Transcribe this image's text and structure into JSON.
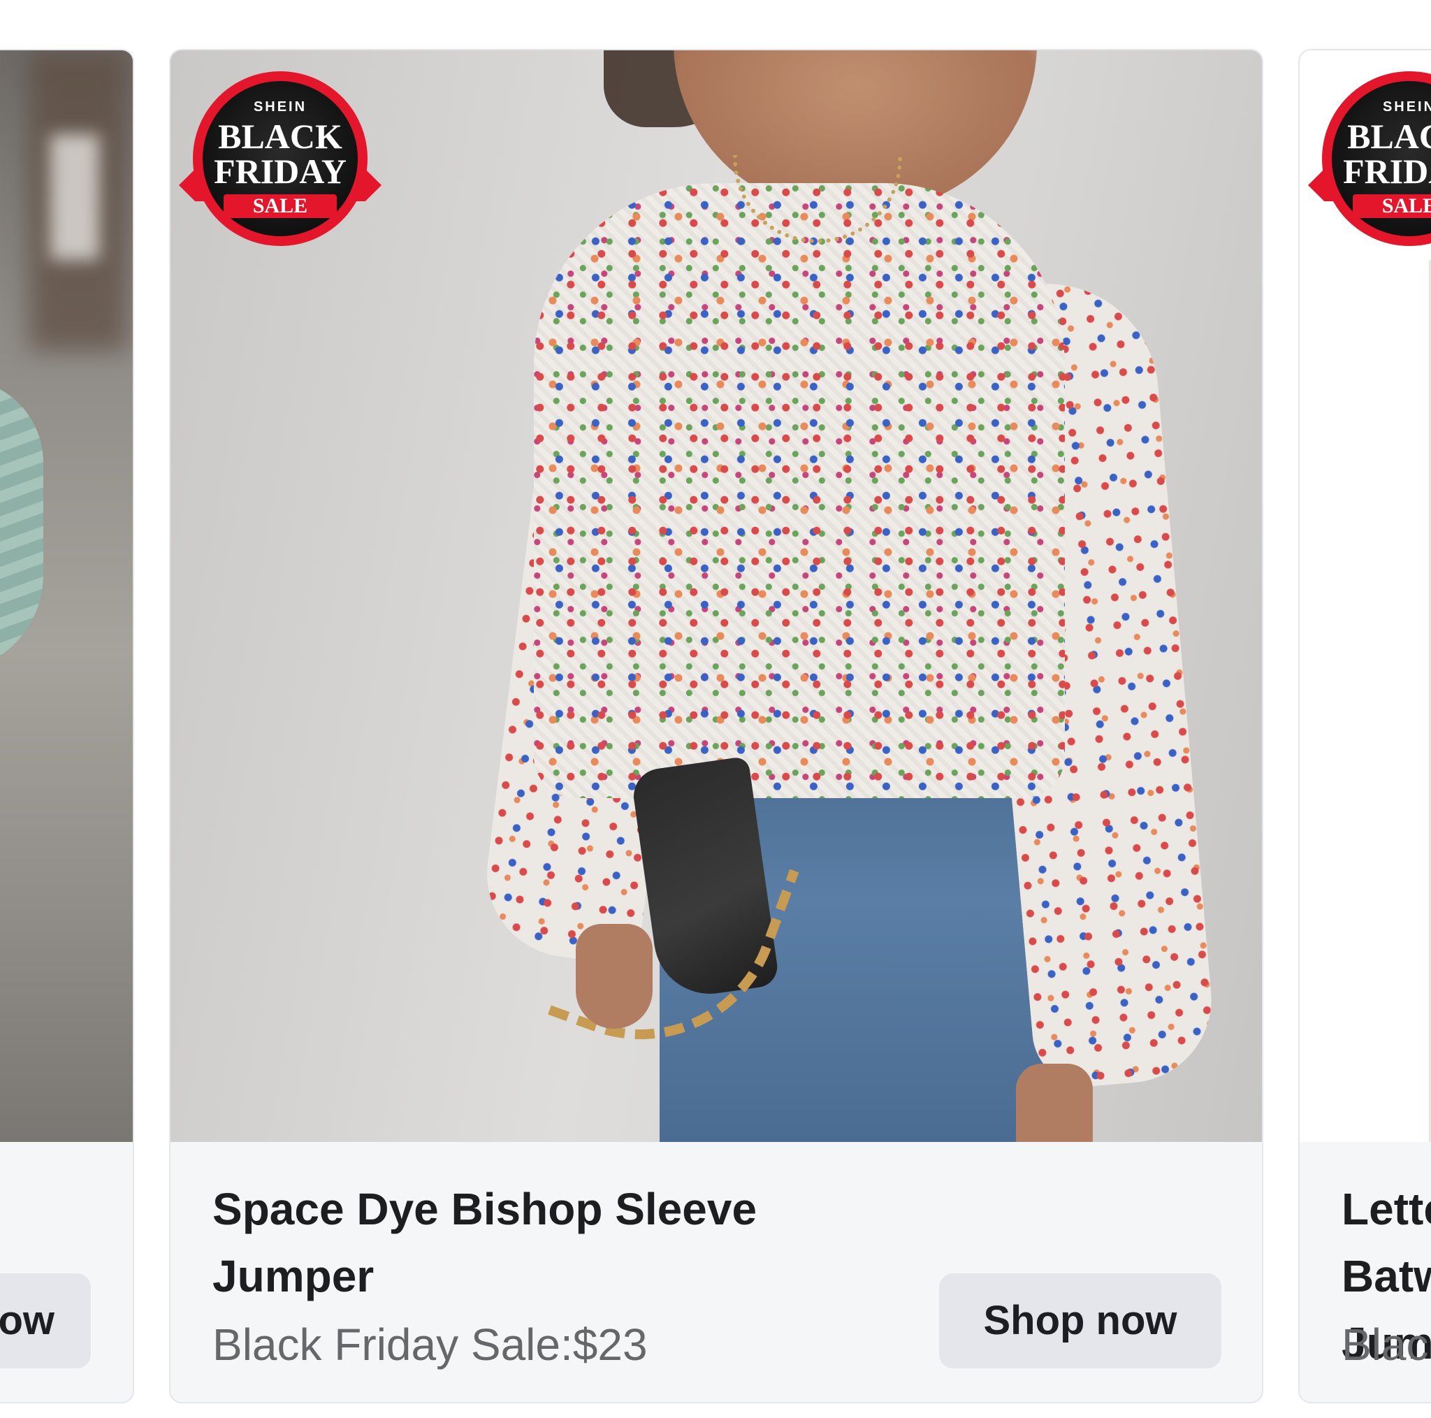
{
  "badge": {
    "brand": "SHEIN",
    "line1": "BLACK",
    "line2": "FRIDAY",
    "sale": "SALE"
  },
  "cards": {
    "left": {
      "button_label": "Shop now"
    },
    "main": {
      "title": "Space Dye Bishop Sleeve Jumper",
      "subtitle": "Black Friday Sale:$23",
      "button_label": "Shop now"
    },
    "right": {
      "title": "Letter Graphic Batwing Sleeve Jumper",
      "subtitle": "Black Friday Sale"
    }
  },
  "colors": {
    "badge_red": "#e3162b",
    "card_background": "#f5f6f8",
    "button_background": "#e4e6eb",
    "title_text": "#1c1e21",
    "subtitle_text": "#65676b"
  }
}
